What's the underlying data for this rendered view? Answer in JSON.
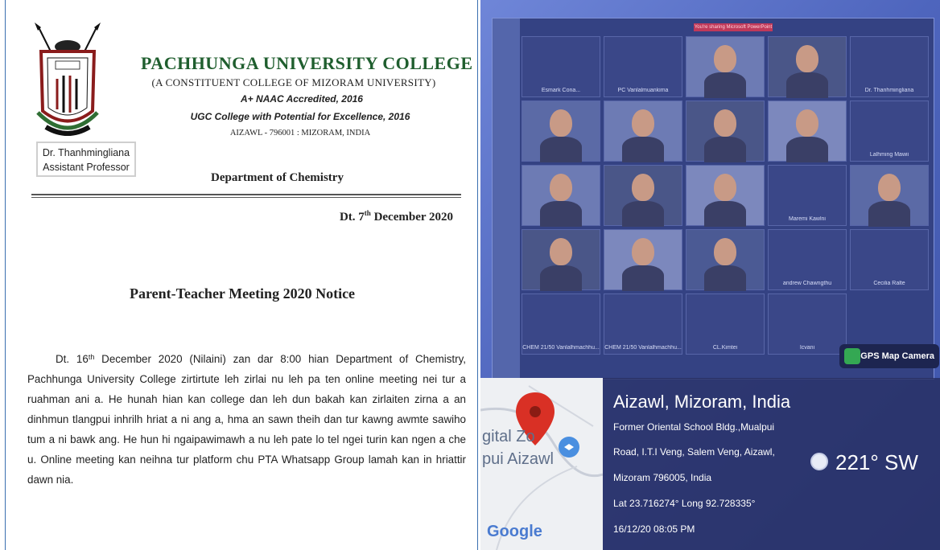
{
  "document": {
    "college_name": "PACHHUNGA UNIVERSITY COLLEGE",
    "affiliation": "(A CONSTITUENT COLLEGE OF MIZORAM UNIVERSITY)",
    "naac": "A+ NAAC Accredited, 2016",
    "ugc": "UGC College with Potential for Excellence, 2016",
    "address": "AIZAWL - 796001 : MIZORAM, INDIA",
    "signatory_name": "Dr. Thanhmingliana",
    "signatory_title": "Assistant Professor",
    "department": "Department of Chemistry",
    "date_prefix": "Dt. 7",
    "date_sup": "th",
    "date_suffix": " December 2020",
    "notice_title": "Parent-Teacher Meeting 2020 Notice",
    "body_prefix": "Dt. 16",
    "body_sup": "th",
    "body_text": " December 2020 (Nilaini) zan dar 8:00 hian Department of Chemistry, Pachhunga University College zirtirtute leh zirlai nu leh pa ten online meeting nei tur a ruahman ani a. He hunah hian kan college dan leh dun bakah kan zirlaiten zirna a an dinhmun tlangpui inhrilh hriat a ni ang a, hma an sawn theih dan tur kawng awmte sawiho tum a ni bawk ang. He hun hi ngaipawimawh a nu leh pate lo tel ngei turin kan ngen a che u. Online meeting kan neihna tur platform chu PTA Whatsapp Group lamah kan in hriattir dawn nia."
  },
  "photo": {
    "share_banner": "You're sharing Microsoft PowerPoint",
    "participants": [
      "Esmark Cona...",
      "PC Vanlalmuankima",
      "",
      "",
      "Dr. Thanhmingliana",
      "",
      "",
      "",
      "",
      "Lalhming Mawii",
      "",
      "",
      "",
      "Maremi Kawlni",
      "",
      "",
      "",
      "",
      "andrew Chawngthu",
      "Cecilia Ralte",
      "CHEM 21/50 Vanlalhmachhu...",
      "CHEM 21/50 Vanlalhmachhu...",
      "CL.Kimtei",
      "Icvani"
    ],
    "gps_badge": "GPS Map Camera",
    "map_label_1": "gital Zo",
    "map_label_2": "pui Aizawl",
    "map_brand": "Google",
    "location_title": "Aizawl, Mizoram, India",
    "address_line_1": "Former Oriental School Bldg.,Mualpui",
    "address_line_2": "Road, I.T.I Veng, Salem Veng, Aizawl,",
    "address_line_3": "Mizoram 796005, India",
    "coords": "Lat 23.716274° Long 92.728335°",
    "timestamp": "16/12/20 08:05 PM",
    "heading": "221° SW"
  }
}
